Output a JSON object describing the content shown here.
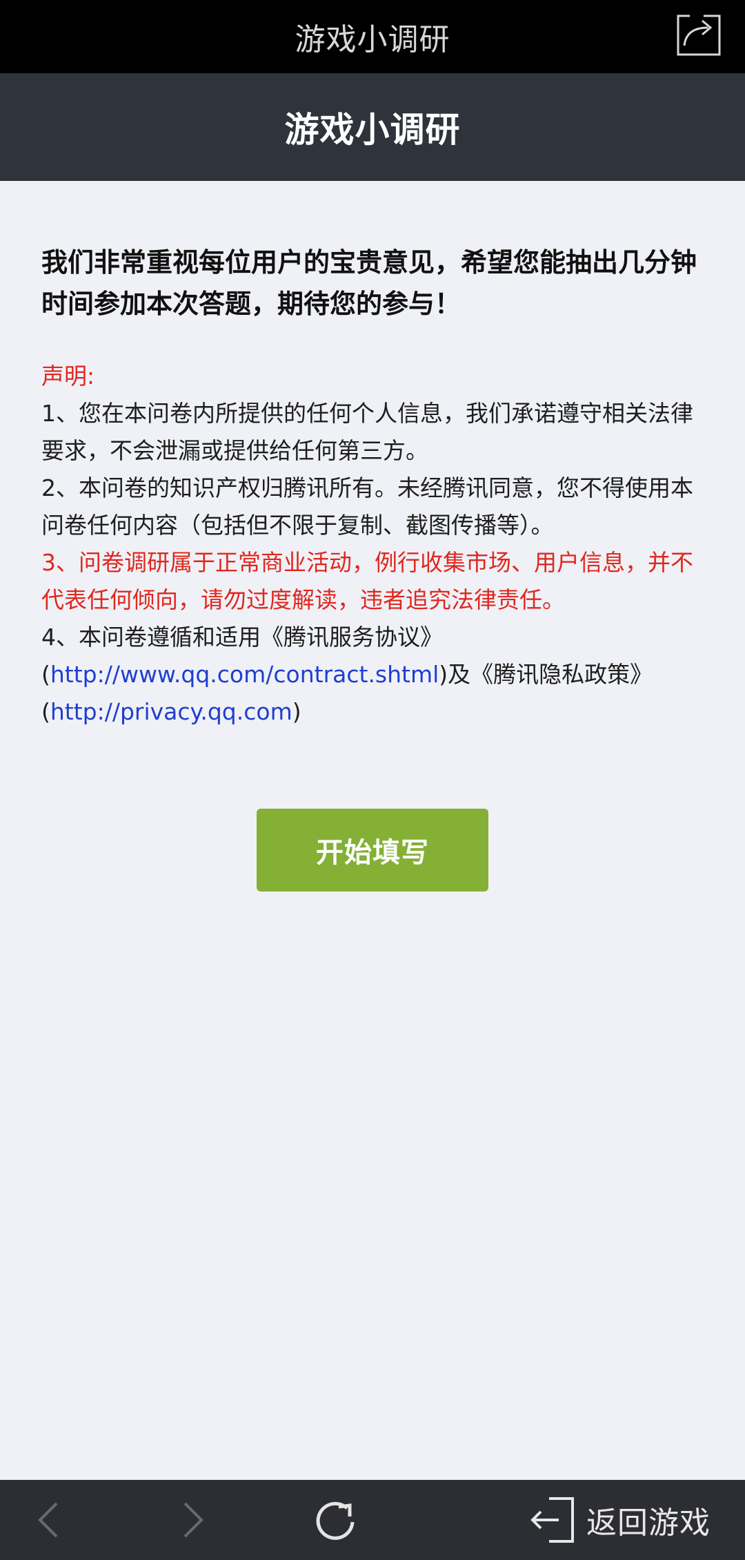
{
  "window": {
    "title": "游戏小调研"
  },
  "header": {
    "title": "游戏小调研"
  },
  "intro": "我们非常重视每位用户的宝贵意见，希望您能抽出几分钟时间参加本次答题，期待您的参与！",
  "statement": {
    "heading": "声明:",
    "item1": "1、您在本问卷内所提供的任何个人信息，我们承诺遵守相关法律要求，不会泄漏或提供给任何第三方。",
    "item2": "2、本问卷的知识产权归腾讯所有。未经腾讯同意，您不得使用本问卷任何内容（包括但不限于复制、截图传播等）。",
    "item3": "3、问卷调研属于正常商业活动，例行收集市场、用户信息，并不代表任何倾向，请勿过度解读，违者追究法律责任。",
    "item4_prefix": "4、本问卷遵循和适用《腾讯服务协议》",
    "paren_open_1": "(",
    "link1": "http://www.qq.com/contract.shtml",
    "item4_middle": ")及《腾讯隐私政策》",
    "paren_open_2": "(",
    "link2": "http://privacy.qq.com",
    "paren_close_2": ")"
  },
  "start_button": "开始填写",
  "bottom_nav": {
    "return_label": "返回游戏"
  },
  "colors": {
    "topbar": "#000000",
    "header": "#2f343c",
    "background": "#eff1f6",
    "accent_green": "#84b036",
    "warning_red": "#e0271e",
    "link_blue": "#1f3ecf",
    "bottombar": "#2d2e33"
  },
  "icons": {
    "share": "share-icon",
    "back": "chevron-left-icon",
    "forward": "chevron-right-icon",
    "reload": "reload-icon",
    "exit": "exit-icon"
  }
}
